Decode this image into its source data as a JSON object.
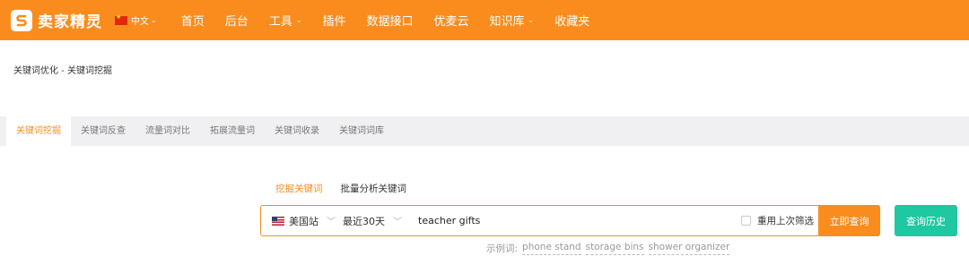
{
  "brand": {
    "name": "卖家精灵"
  },
  "language": {
    "label": "中文",
    "flag": "china-flag"
  },
  "nav": {
    "items": [
      {
        "label": "首页",
        "dropdown": false
      },
      {
        "label": "后台",
        "dropdown": false
      },
      {
        "label": "工具",
        "dropdown": true
      },
      {
        "label": "插件",
        "dropdown": false
      },
      {
        "label": "数据接口",
        "dropdown": false
      },
      {
        "label": "优麦云",
        "dropdown": false
      },
      {
        "label": "知识库",
        "dropdown": true
      },
      {
        "label": "收藏夹",
        "dropdown": false
      }
    ]
  },
  "breadcrumb": {
    "text": "关键词优化 - 关键词挖掘"
  },
  "tabs": {
    "items": [
      {
        "label": "关键词挖掘",
        "active": true
      },
      {
        "label": "关键词反查",
        "active": false
      },
      {
        "label": "流量词对比",
        "active": false
      },
      {
        "label": "拓展流量词",
        "active": false
      },
      {
        "label": "关键词收录",
        "active": false
      },
      {
        "label": "关键词词库",
        "active": false
      }
    ]
  },
  "mode_tabs": {
    "items": [
      {
        "label": "挖掘关键词",
        "active": true
      },
      {
        "label": "批量分析关键词",
        "active": false
      }
    ]
  },
  "search": {
    "site": "美国站",
    "site_flag": "us-flag",
    "range": "最近30天",
    "keyword": "teacher gifts",
    "reuse_label": "重用上次筛选",
    "reuse_checked": false,
    "query_label": "立即查询",
    "history_label": "查询历史"
  },
  "examples": {
    "label": "示例词:",
    "items": [
      "phone stand",
      "storage bins",
      "shower organizer"
    ]
  },
  "colors": {
    "accent": "#fa8c1e",
    "secondary": "#1ec8a0",
    "band": "#f0f0f2"
  }
}
